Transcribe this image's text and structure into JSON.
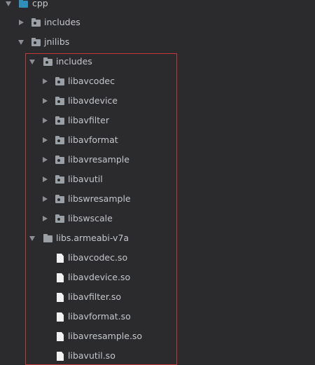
{
  "tree": {
    "root": {
      "label": "cpp",
      "expanded": true
    },
    "includes": {
      "label": "includes",
      "expanded": false
    },
    "jnilibs": {
      "label": "jnilibs",
      "expanded": true
    },
    "jnilibs_includes": {
      "label": "includes",
      "expanded": true,
      "children": [
        "libavcodec",
        "libavdevice",
        "libavfilter",
        "libavformat",
        "libavresample",
        "libavutil",
        "libswresample",
        "libswscale"
      ]
    },
    "libs_folder": {
      "label": "libs.armeabi-v7a",
      "expanded": true,
      "files": [
        "libavcodec.so",
        "libavdevice.so",
        "libavfilter.so",
        "libavformat.so",
        "libavresample.so",
        "libavutil.so"
      ]
    }
  },
  "colors": {
    "background": "#2b2b2d",
    "text": "#c3c7cc",
    "selection_border": "#c0393b",
    "root_folder": "#2f8fb8"
  }
}
